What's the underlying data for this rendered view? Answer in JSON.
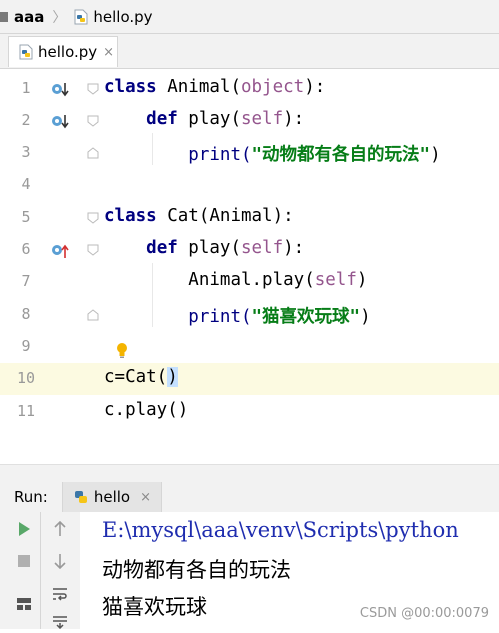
{
  "breadcrumb": {
    "project": "aaa",
    "file": "hello.py"
  },
  "editor_tab": {
    "label": "hello.py",
    "close": "×"
  },
  "code_lines": [
    {
      "num": "1"
    },
    {
      "num": "2"
    },
    {
      "num": "3"
    },
    {
      "num": "4"
    },
    {
      "num": "5"
    },
    {
      "num": "6"
    },
    {
      "num": "7"
    },
    {
      "num": "8"
    },
    {
      "num": "9"
    },
    {
      "num": "10"
    },
    {
      "num": "11"
    }
  ],
  "code": {
    "l1_kw": "class",
    "l1_rest": " Animal(",
    "l1_obj": "object",
    "l1_end": "):",
    "l2_kw": "def",
    "l2_name": " play(",
    "l2_self": "self",
    "l2_end": "):",
    "l3_print": "print(",
    "l3_str": "\"动物都有各自的玩法\"",
    "l3_end": ")",
    "l5_kw": "class",
    "l5_rest": " Cat(Animal):",
    "l6_kw": "def",
    "l6_name": " play(",
    "l6_self": "self",
    "l6_end": "):",
    "l7_a": "Animal.play(",
    "l7_self": "self",
    "l7_end": ")",
    "l8_print": "print(",
    "l8_str": "\"猫喜欢玩球\"",
    "l8_end": ")",
    "l10_a": "c=Cat(",
    "l10_b": ")",
    "l11": "c.play()"
  },
  "run_panel": {
    "label": "Run:",
    "tab": "hello",
    "close": "×"
  },
  "console": {
    "line1": "E:\\mysql\\aaa\\venv\\Scripts\\python",
    "line2": "动物都有各自的玩法",
    "line3": "猫喜欢玩球"
  },
  "watermark": "CSDN @00:00:0079",
  "colors": {
    "keyword": "#000080",
    "self": "#94558d",
    "string": "#067d17",
    "console_cmd": "#1f2daf"
  }
}
